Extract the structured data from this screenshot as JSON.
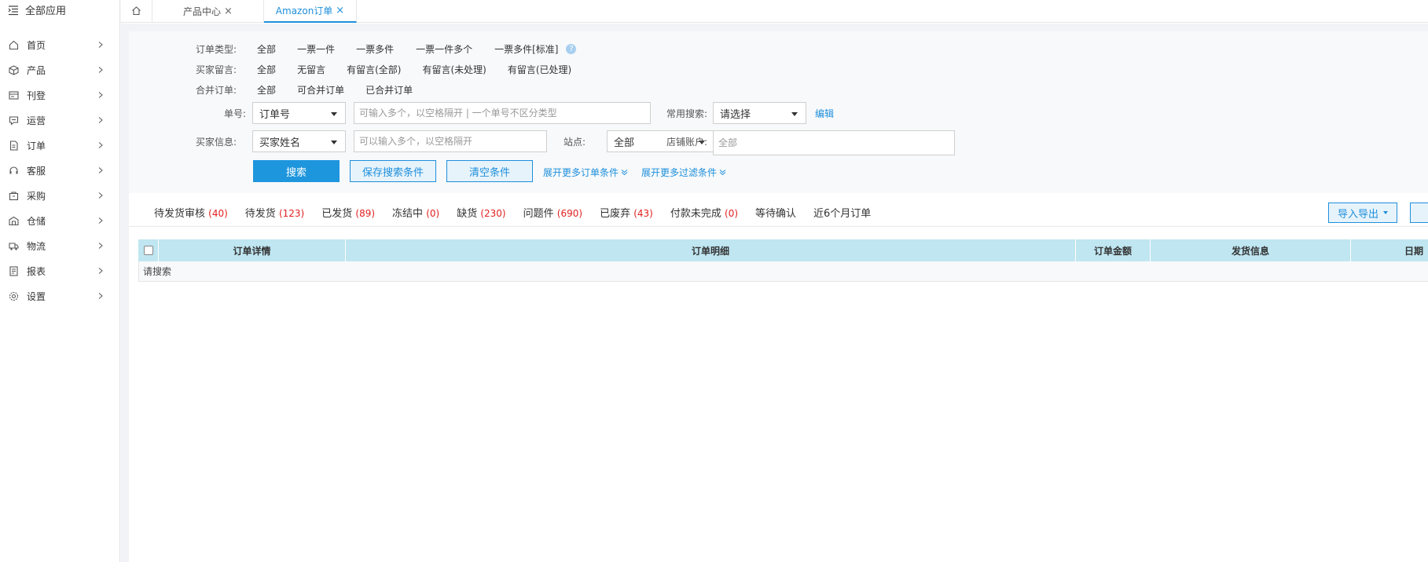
{
  "sidebar": {
    "title": "全部应用",
    "items": [
      {
        "label": "首页",
        "icon": "home-icon"
      },
      {
        "label": "产品",
        "icon": "box-icon"
      },
      {
        "label": "刊登",
        "icon": "publish-icon"
      },
      {
        "label": "运营",
        "icon": "chat-icon"
      },
      {
        "label": "订单",
        "icon": "document-icon"
      },
      {
        "label": "客服",
        "icon": "headset-icon"
      },
      {
        "label": "采购",
        "icon": "purchase-icon"
      },
      {
        "label": "仓储",
        "icon": "warehouse-icon"
      },
      {
        "label": "物流",
        "icon": "truck-icon"
      },
      {
        "label": "报表",
        "icon": "report-icon"
      },
      {
        "label": "设置",
        "icon": "gear-icon"
      }
    ]
  },
  "tabs": {
    "items": [
      {
        "label": "产品中心",
        "close": "×"
      },
      {
        "label": "Amazon订单",
        "close": "×"
      }
    ]
  },
  "filters": {
    "order_type": {
      "label": "订单类型:",
      "options": [
        "全部",
        "一票一件",
        "一票多件",
        "一票一件多个",
        "一票多件[标准]"
      ],
      "help": "?"
    },
    "buyer_msg": {
      "label": "买家留言:",
      "options": [
        "全部",
        "无留言",
        "有留言(全部)",
        "有留言(未处理)",
        "有留言(已处理)"
      ]
    },
    "merge": {
      "label": "合并订单:",
      "options": [
        "全部",
        "可合并订单",
        "已合并订单"
      ]
    },
    "order_no": {
      "label": "单号:",
      "select_value": "订单号",
      "placeholder": "可输入多个，以空格隔开 | 一个单号不区分类型"
    },
    "common_search": {
      "label": "常用搜索:",
      "select_value": "请选择",
      "edit": "编辑"
    },
    "buyer_info": {
      "label": "买家信息:",
      "select_value": "买家姓名",
      "placeholder": "可以输入多个，以空格隔开"
    },
    "site": {
      "label": "站点:",
      "select_value": "全部"
    },
    "shop": {
      "label": "店铺账户:",
      "placeholder": "全部"
    },
    "buttons": {
      "search": "搜索",
      "save": "保存搜索条件",
      "clear": "清空条件",
      "more_order": "展开更多订单条件",
      "more_filter": "展开更多过滤条件"
    }
  },
  "status_tabs": [
    {
      "label": "待发货审核",
      "count": "(40)"
    },
    {
      "label": "待发货",
      "count": "(123)"
    },
    {
      "label": "已发货",
      "count": "(89)"
    },
    {
      "label": "冻结中",
      "count": "(0)"
    },
    {
      "label": "缺货",
      "count": "(230)"
    },
    {
      "label": "问题件",
      "count": "(690)"
    },
    {
      "label": "已废弃",
      "count": "(43)"
    },
    {
      "label": "付款未完成",
      "count": "(0)"
    },
    {
      "label": "等待确认",
      "count": ""
    },
    {
      "label": "近6个月订单",
      "count": ""
    }
  ],
  "actions": {
    "import_export": "导入导出"
  },
  "table": {
    "columns": [
      "订单详情",
      "订单明细",
      "订单金额",
      "发货信息",
      "日期"
    ],
    "empty_text": "请搜索"
  },
  "colors": {
    "accent": "#1e8fdb",
    "count": "#e02020",
    "table_header": "#bfe6f1"
  }
}
